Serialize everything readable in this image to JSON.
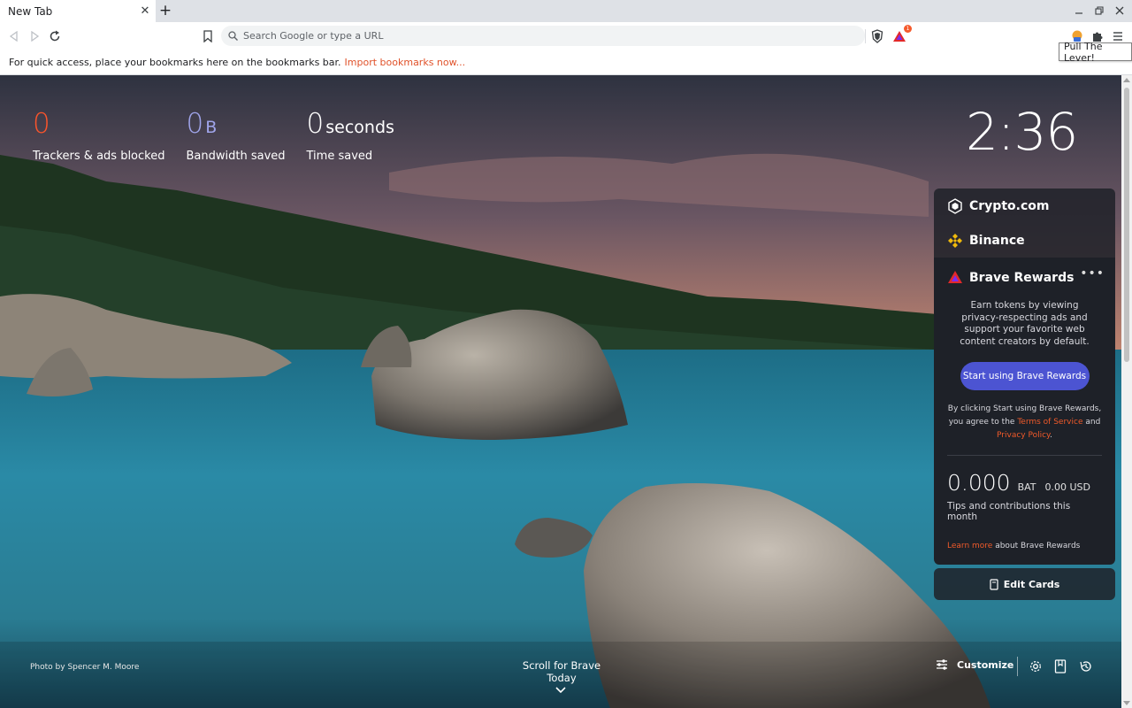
{
  "tab": {
    "title": "New Tab"
  },
  "toolbar": {
    "omnibox_placeholder": "Search Google or type a URL",
    "rewards_badge": "1",
    "tooltip": "Pull The Lever!"
  },
  "bookmarks_bar": {
    "message": "For quick access, place your bookmarks here on the bookmarks bar.",
    "import_link": "Import bookmarks now..."
  },
  "stats": [
    {
      "value": "0",
      "unit": "",
      "label": "Trackers & ads blocked",
      "color": "#fb542b"
    },
    {
      "value": "0",
      "unit": "B",
      "label": "Bandwidth saved",
      "color": "#a0a5eb"
    },
    {
      "value": "0",
      "unit": "seconds",
      "label": "Time saved",
      "color": "#ffffff"
    }
  ],
  "clock": "2:36",
  "widgets": {
    "crypto": {
      "label": "Crypto.com"
    },
    "binance": {
      "label": "Binance"
    },
    "rewards": {
      "title": "Brave Rewards",
      "more": "•••",
      "description": "Earn tokens by viewing privacy-respecting ads and support your favorite web content creators by default.",
      "cta": "Start using Brave Rewards",
      "legal_prefix": "By clicking Start using Brave Rewards, you agree to the",
      "terms": "Terms of Service",
      "and": "and",
      "privacy": "Privacy Policy",
      "period": ".",
      "balance": "0.000",
      "balance_unit": "BAT",
      "balance_usd": "0.00 USD",
      "balance_label": "Tips and contributions this month",
      "learn_more": "Learn more",
      "learn_suffix": "about Brave Rewards"
    },
    "edit_cards": "Edit Cards"
  },
  "footer": {
    "photo_by": "Photo by",
    "photographer": "Spencer M. Moore",
    "scroll_today": "Scroll for Brave Today",
    "customize": "Customize"
  },
  "colors": {
    "brave_orange": "#fb542b",
    "rewards_button": "#4c54d2",
    "widget_bg": "#1e2128"
  }
}
